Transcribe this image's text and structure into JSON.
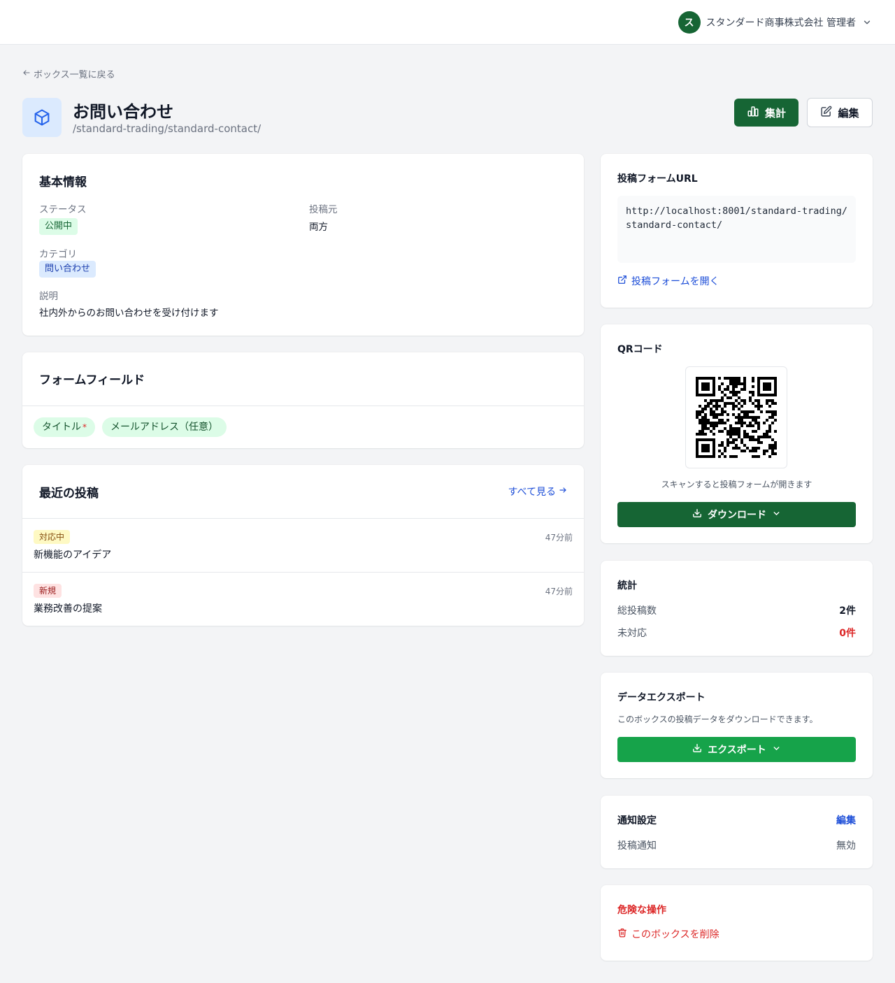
{
  "user": {
    "avatar_initial": "ス",
    "name": "スタンダード商事株式会社 管理者"
  },
  "back_link": "ボックス一覧に戻る",
  "header": {
    "title": "お問い合わせ",
    "path": "/standard-trading/standard-contact/",
    "aggregate_label": "集計",
    "edit_label": "編集"
  },
  "basic": {
    "title": "基本情報",
    "status_label": "ステータス",
    "status_value": "公開中",
    "source_label": "投稿元",
    "source_value": "両方",
    "category_label": "カテゴリ",
    "category_value": "問い合わせ",
    "description_label": "説明",
    "description_value": "社内外からのお問い合わせを受け付けます"
  },
  "fields": {
    "title": "フォームフィールド",
    "items": [
      {
        "label": "タイトル",
        "required": "*"
      },
      {
        "label": "メールアドレス（任意）"
      }
    ]
  },
  "posts": {
    "title": "最近の投稿",
    "see_all": "すべて見る",
    "items": [
      {
        "status": "対応中",
        "time": "47分前",
        "title": "新機能のアイデア"
      },
      {
        "status": "新規",
        "time": "47分前",
        "title": "業務改善の提案"
      }
    ]
  },
  "form_url": {
    "title": "投稿フォームURL",
    "url": "http://localhost:8001/standard-trading/standard-contact/",
    "open_label": "投稿フォームを開く"
  },
  "qr": {
    "title": "QRコード",
    "caption": "スキャンすると投稿フォームが開きます",
    "download_label": "ダウンロード"
  },
  "stats": {
    "title": "統計",
    "total_label": "総投稿数",
    "total_value": "2件",
    "pending_label": "未対応",
    "pending_value": "0件"
  },
  "export": {
    "title": "データエクスポート",
    "description": "このボックスの投稿データをダウンロードできます。",
    "button_label": "エクスポート"
  },
  "notify": {
    "title": "通知設定",
    "edit_label": "編集",
    "post_notify_label": "投稿通知",
    "post_notify_value": "無効"
  },
  "danger": {
    "title": "危険な操作",
    "delete_label": "このボックスを削除"
  },
  "colors": {
    "primary_green": "#166534",
    "export_green": "#16a34a",
    "link_blue": "#1d4ed8",
    "danger_red": "#dc2626"
  }
}
